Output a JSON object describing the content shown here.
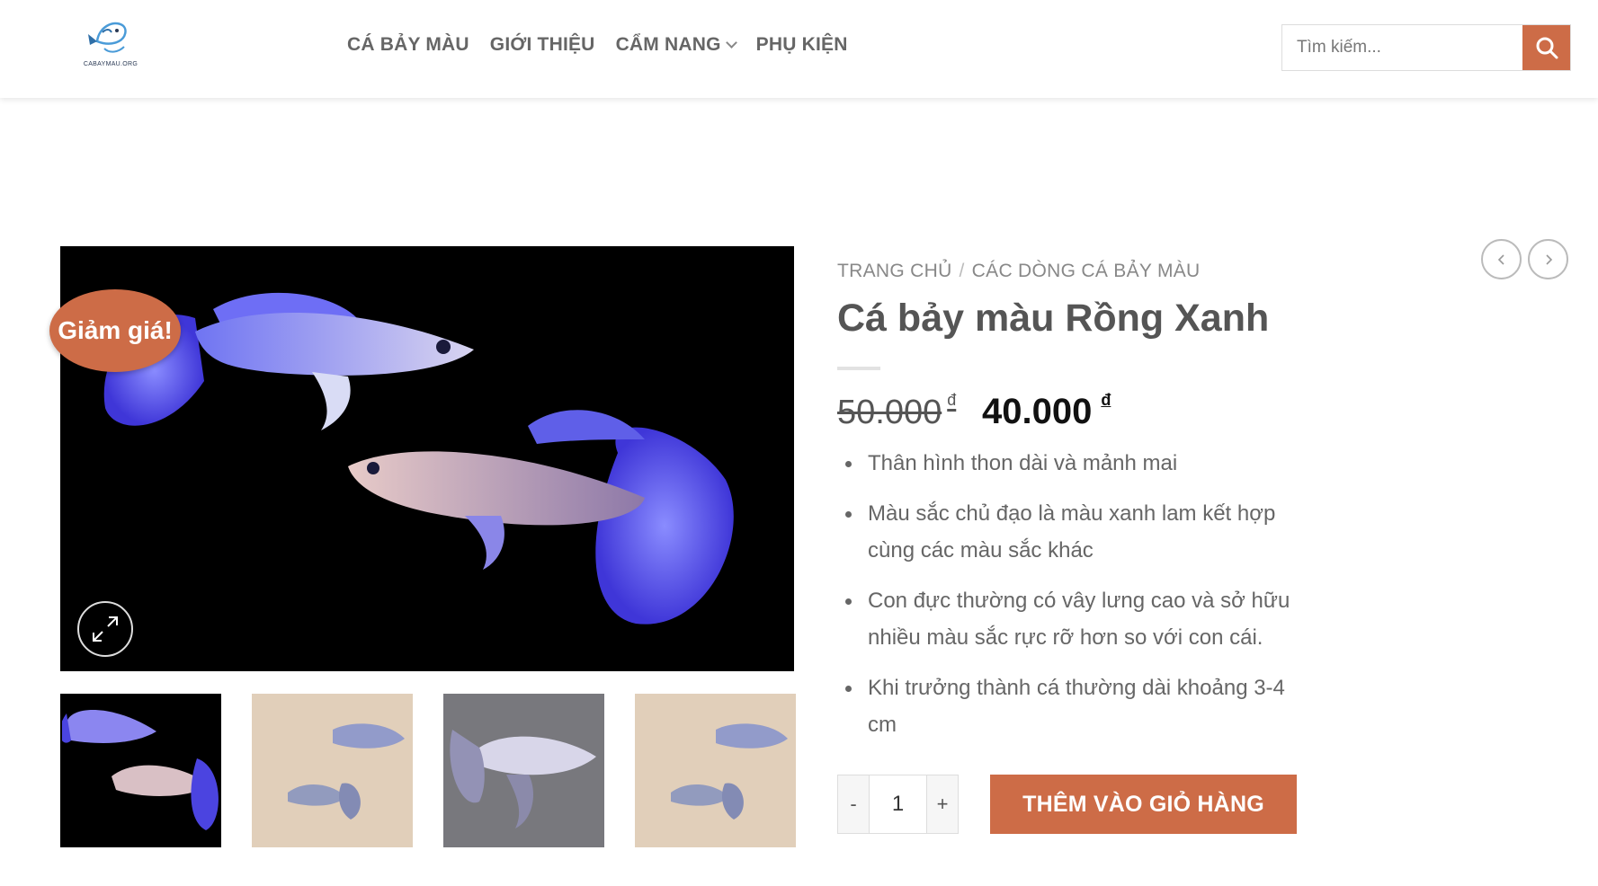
{
  "header": {
    "logo_text": "CABAYMAU.ORG",
    "nav": [
      {
        "label": "CÁ BẢY MÀU"
      },
      {
        "label": "GIỚI THIỆU"
      },
      {
        "label": "CẨM NANG"
      },
      {
        "label": "PHỤ KIỆN"
      }
    ],
    "search_placeholder": "Tìm kiếm..."
  },
  "gallery": {
    "sale_badge": "Giảm giá!"
  },
  "product": {
    "breadcrumb": [
      "TRANG CHỦ",
      "CÁC DÒNG CÁ BẢY MÀU"
    ],
    "breadcrumb_sep": "/",
    "title": "Cá bảy màu Rồng Xanh",
    "price_old": "50.000",
    "price_new": "40.000",
    "currency": "đ",
    "features": [
      "Thân hình thon dài và mảnh mai",
      "Màu sắc chủ đạo là màu xanh lam kết hợp cùng các màu sắc khác",
      "Con đực thường có vây lưng cao và sở hữu nhiều màu sắc rực rỡ hơn so với con cái.",
      "Khi trưởng thành cá thường dài khoảng 3-4 cm"
    ],
    "quantity": "1",
    "qty_minus": "-",
    "qty_plus": "+",
    "add_to_cart": "THÊM VÀO GIỎ HÀNG"
  },
  "colors": {
    "accent": "#cd6c47",
    "text": "#555555",
    "fish_blue": "#5b5ff0"
  }
}
